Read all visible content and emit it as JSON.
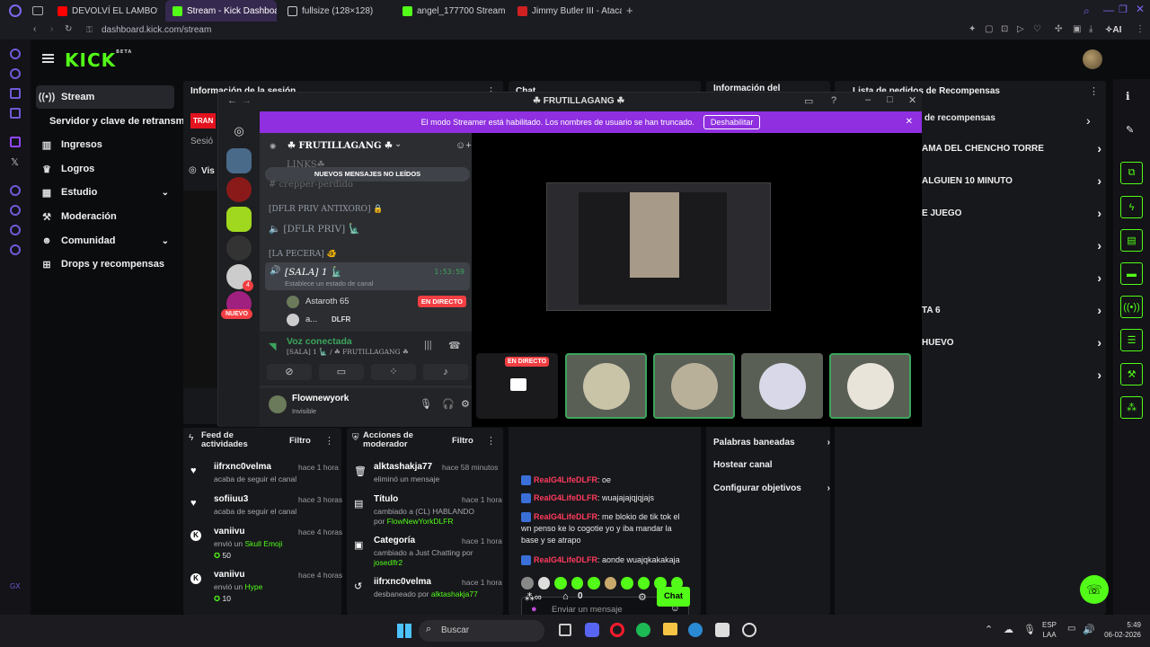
{
  "browser": {
    "tabs": [
      {
        "label": "DEVOLVÍ EL LAMBO? | WE",
        "color": "#ff0000"
      },
      {
        "label": "Stream - Kick Dashboard",
        "color": "#53fc18"
      },
      {
        "label": "fullsize (128×128)",
        "color": "#cccccc"
      },
      {
        "label": "angel_177700 Stream - W",
        "color": "#53fc18"
      },
      {
        "label": "Jimmy Butler III - Atacante",
        "color": "#d02020"
      }
    ],
    "url": "dashboard.kick.com/stream",
    "ai_label": "AI"
  },
  "kick": {
    "logo": "KICK",
    "logo_beta": "BETA",
    "sidebar": {
      "items": [
        {
          "label": "Stream",
          "icon": "broadcast-icon"
        },
        {
          "label": "Servidor y clave de retransm",
          "icon": ""
        },
        {
          "label": "Ingresos",
          "icon": "chart-icon"
        },
        {
          "label": "Logros",
          "icon": "trophy-icon"
        },
        {
          "label": "Estudio",
          "icon": "grid-icon"
        },
        {
          "label": "Moderación",
          "icon": "hammer-icon"
        },
        {
          "label": "Comunidad",
          "icon": "people-icon"
        },
        {
          "label": "Drops y recompensas",
          "icon": "gift-icon"
        }
      ]
    },
    "session": {
      "title": "Información de la sesión",
      "badge": "TRAN",
      "label": "Sesió"
    },
    "chat_header": "Chat",
    "channel_info_header": "Información del",
    "rewards": {
      "title": "Lista de pedidos de Recompensas",
      "subtitle": "de recompensas",
      "items": [
        "AMA DEL CHENCHO TORRE",
        "ALGUIEN 10 MINUTO",
        "E JUEGO",
        "",
        "",
        "TA 6",
        "HUEVO",
        ""
      ]
    },
    "preview_label": "Vis",
    "feed": {
      "title": "Feed de actividades",
      "filter": "Filtro",
      "items": [
        {
          "name": "iifrxnc0velma",
          "time": "hace 1 hora",
          "text": "acaba de seguir el canal",
          "amount": ""
        },
        {
          "name": "sofiiuu3",
          "time": "hace 3 horas",
          "text": "acaba de seguir el canal",
          "amount": ""
        },
        {
          "name": "vaniivu",
          "time": "hace 4 horas",
          "text": "envió un",
          "gift": "Skull Emoji",
          "amount": "50"
        },
        {
          "name": "vaniivu",
          "time": "hace 4 horas",
          "text": "envió un",
          "gift": "Hype",
          "amount": "10"
        }
      ]
    },
    "mod_actions": {
      "title": "Acciones de moderador",
      "filter": "Filtro",
      "items": [
        {
          "name": "alktashakja77",
          "time": "hace 58 minutos",
          "text": "eliminó un mensaje",
          "extra": "",
          "by": ""
        },
        {
          "name": "Título",
          "time": "hace 1 hora",
          "text": "cambiado a (CL) HABLANDO",
          "extra": "por",
          "by": "FlowNewYorkDLFR"
        },
        {
          "name": "Categoría",
          "time": "hace 1 hora",
          "text": "cambiado a Just Chatting por",
          "extra": "",
          "by": "josedlfr2"
        },
        {
          "name": "iifrxnc0velma",
          "time": "hace 1 hora",
          "text": "desbaneado por",
          "extra": "",
          "by": "alktashakja77"
        }
      ]
    },
    "chat": {
      "messages": [
        {
          "user": "RealG4LifeDLFR",
          "text": ": oe"
        },
        {
          "user": "RealG4LifeDLFR",
          "text": ": wuajajajqjqjajs"
        },
        {
          "user": "RealG4LifeDLFR",
          "text": ": me blokio de tik tok el wn penso ke lo cogotie yo y iba mandar la base y se atrapo"
        },
        {
          "user": "RealG4LifeDLFR",
          "text": ": aonde wuajqkakakaja"
        }
      ],
      "input_placeholder": "Enviar un mensaje",
      "points": "0",
      "send_label": "Chat"
    },
    "channel_options": [
      {
        "label": "Palabras baneadas",
        "arrow": true
      },
      {
        "label": "Hostear canal",
        "arrow": false
      },
      {
        "label": "Configurar objetivos",
        "arrow": true
      }
    ]
  },
  "discord": {
    "window_title": "☘ FRUTILLAGANG ☘",
    "streamer_banner": "El modo Streamer está habilitado. Los nombres de usuario se han truncado.",
    "streamer_button": "Deshabilitar",
    "server_name": "☘ FRUTILLAGANG ☘",
    "new_messages": "NUEVOS MENSAJES NO LEÍDOS",
    "channels": {
      "links": "LINKS☘",
      "crepper": "crepper-perdido",
      "cat1": "[DFLR PRIV ANTIXORO] 🔒",
      "priv": "[DFLR PRIV] 🗽",
      "cat2": "[LA PECERA] 🐠",
      "sala": "[SALA] 1 🗽",
      "sala_time": "1:53:59",
      "sala_status": "Establece un estado de canal",
      "member1": "Astaroth 65",
      "member1_badge": "EN DIRECTO",
      "member2": "a...",
      "member2_tag": "DLFR"
    },
    "new_badge": "NUEVO",
    "guild_badge": "4",
    "voice": {
      "status": "Voz conectada",
      "location": "[SALA] 1 🗽 / ☘ FRUTILLAGANG ☘"
    },
    "user": {
      "name": "Flownewyork",
      "status": "Invisible"
    },
    "live_label": "EN DIRECTO"
  },
  "taskbar": {
    "search": "Buscar",
    "lang1": "ESP",
    "lang2": "LAA",
    "time": "5:49",
    "date": "06-02-2026"
  }
}
